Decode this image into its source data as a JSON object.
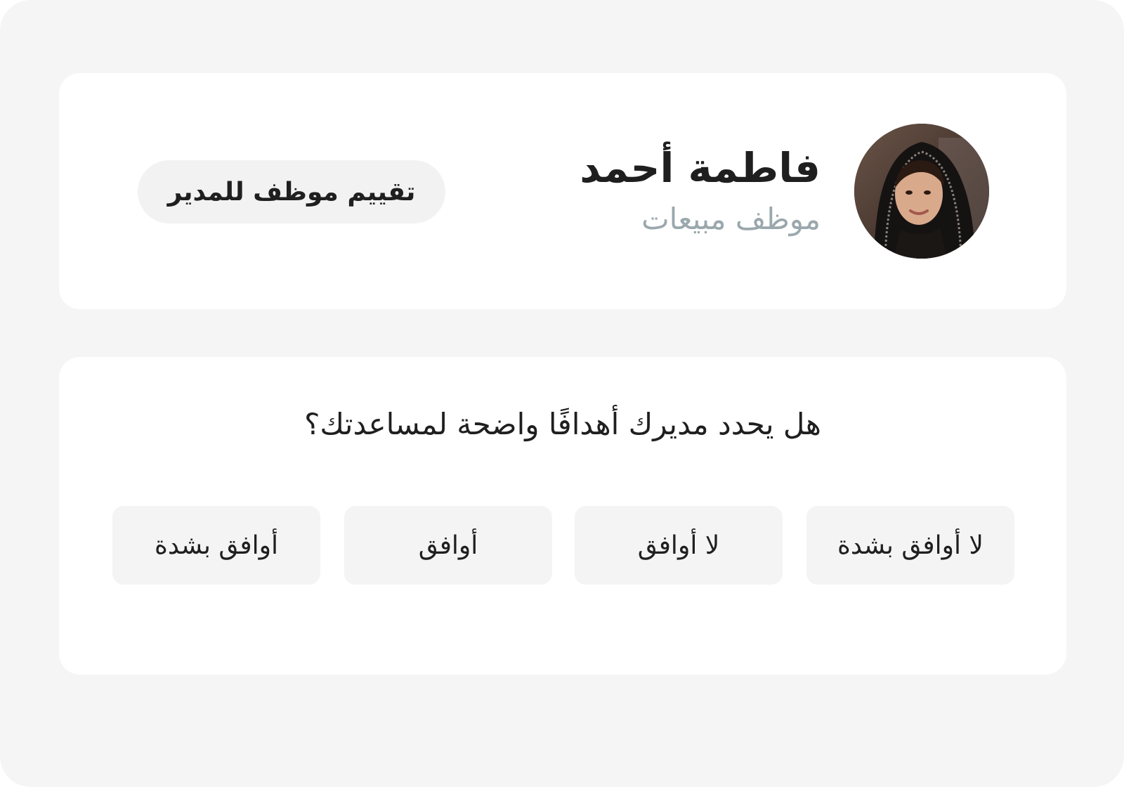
{
  "profile": {
    "name": "فاطمة أحمد",
    "role": "موظف مبيعات",
    "avatar_icon": "person-photo",
    "review_button_label": "تقييم موظف للمدير"
  },
  "survey": {
    "question": "هل يحدد مديرك أهدافًا واضحة لمساعدتك؟",
    "options": [
      {
        "label": "لا أوافق بشدة"
      },
      {
        "label": "لا أوافق"
      },
      {
        "label": "أوافق"
      },
      {
        "label": "أوافق بشدة"
      }
    ]
  },
  "colors": {
    "page_background": "#f5f5f5",
    "card_background": "#ffffff",
    "button_background": "#f2f2f2",
    "primary_text": "#1f1f1f",
    "secondary_text": "#9aa8ad"
  }
}
